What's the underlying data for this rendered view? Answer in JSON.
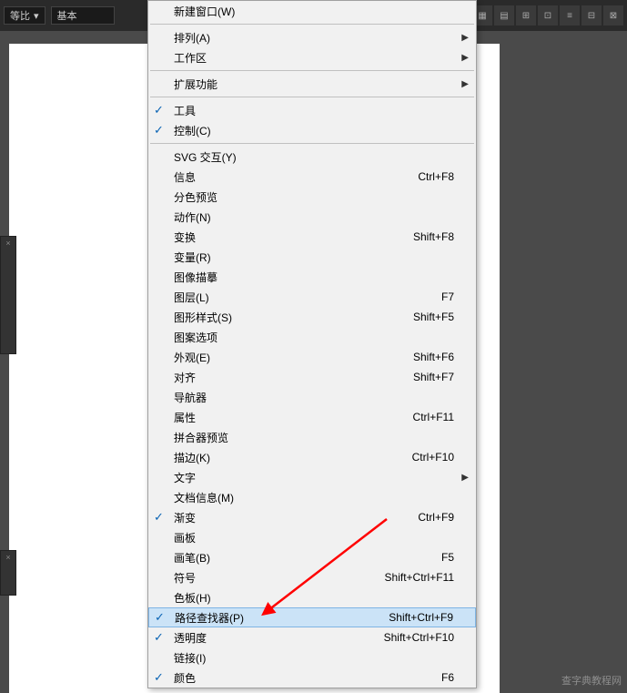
{
  "toolbar": {
    "ratio_label": "等比",
    "basic_label": "基本",
    "icons": [
      "▦",
      "▤",
      "⊞",
      "⊡",
      "≡",
      "⊟",
      "⊠"
    ]
  },
  "menu": {
    "items": [
      {
        "label": "新建窗口(W)",
        "shortcut": "",
        "checked": false,
        "submenu": false
      },
      {
        "sep": true
      },
      {
        "label": "排列(A)",
        "shortcut": "",
        "checked": false,
        "submenu": true
      },
      {
        "label": "工作区",
        "shortcut": "",
        "checked": false,
        "submenu": true
      },
      {
        "sep": true
      },
      {
        "label": "扩展功能",
        "shortcut": "",
        "checked": false,
        "submenu": true
      },
      {
        "sep": true
      },
      {
        "label": "工具",
        "shortcut": "",
        "checked": true,
        "submenu": false
      },
      {
        "label": "控制(C)",
        "shortcut": "",
        "checked": true,
        "submenu": false
      },
      {
        "sep": true
      },
      {
        "label": "SVG 交互(Y)",
        "shortcut": "",
        "checked": false,
        "submenu": false
      },
      {
        "label": "信息",
        "shortcut": "Ctrl+F8",
        "checked": false,
        "submenu": false
      },
      {
        "label": "分色预览",
        "shortcut": "",
        "checked": false,
        "submenu": false
      },
      {
        "label": "动作(N)",
        "shortcut": "",
        "checked": false,
        "submenu": false
      },
      {
        "label": "变换",
        "shortcut": "Shift+F8",
        "checked": false,
        "submenu": false
      },
      {
        "label": "变量(R)",
        "shortcut": "",
        "checked": false,
        "submenu": false
      },
      {
        "label": "图像描摹",
        "shortcut": "",
        "checked": false,
        "submenu": false
      },
      {
        "label": "图层(L)",
        "shortcut": "F7",
        "checked": false,
        "submenu": false
      },
      {
        "label": "图形样式(S)",
        "shortcut": "Shift+F5",
        "checked": false,
        "submenu": false
      },
      {
        "label": "图案选项",
        "shortcut": "",
        "checked": false,
        "submenu": false
      },
      {
        "label": "外观(E)",
        "shortcut": "Shift+F6",
        "checked": false,
        "submenu": false
      },
      {
        "label": "对齐",
        "shortcut": "Shift+F7",
        "checked": false,
        "submenu": false
      },
      {
        "label": "导航器",
        "shortcut": "",
        "checked": false,
        "submenu": false
      },
      {
        "label": "属性",
        "shortcut": "Ctrl+F11",
        "checked": false,
        "submenu": false
      },
      {
        "label": "拼合器预览",
        "shortcut": "",
        "checked": false,
        "submenu": false
      },
      {
        "label": "描边(K)",
        "shortcut": "Ctrl+F10",
        "checked": false,
        "submenu": false
      },
      {
        "label": "文字",
        "shortcut": "",
        "checked": false,
        "submenu": true
      },
      {
        "label": "文档信息(M)",
        "shortcut": "",
        "checked": false,
        "submenu": false
      },
      {
        "label": "渐变",
        "shortcut": "Ctrl+F9",
        "checked": true,
        "submenu": false
      },
      {
        "label": "画板",
        "shortcut": "",
        "checked": false,
        "submenu": false
      },
      {
        "label": "画笔(B)",
        "shortcut": "F5",
        "checked": false,
        "submenu": false
      },
      {
        "label": "符号",
        "shortcut": "Shift+Ctrl+F11",
        "checked": false,
        "submenu": false
      },
      {
        "label": "色板(H)",
        "shortcut": "",
        "checked": false,
        "submenu": false
      },
      {
        "label": "路径查找器(P)",
        "shortcut": "Shift+Ctrl+F9",
        "checked": true,
        "submenu": false,
        "highlighted": true
      },
      {
        "label": "透明度",
        "shortcut": "Shift+Ctrl+F10",
        "checked": true,
        "submenu": false
      },
      {
        "label": "链接(I)",
        "shortcut": "",
        "checked": false,
        "submenu": false
      },
      {
        "label": "颜色",
        "shortcut": "F6",
        "checked": true,
        "submenu": false
      }
    ]
  },
  "watermark": "查字典教程网"
}
